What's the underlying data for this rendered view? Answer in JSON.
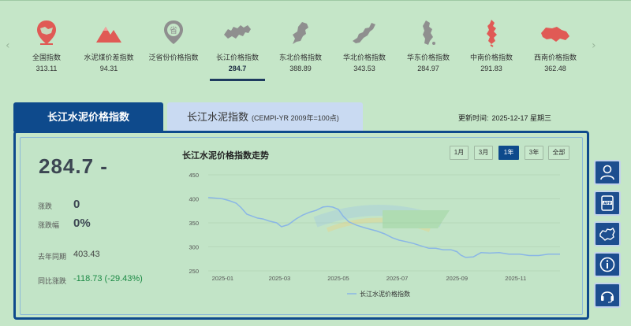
{
  "strip": {
    "prev_arrow": "‹",
    "next_arrow": "›",
    "items": [
      {
        "name": "全国指数",
        "value": "313.11",
        "icon": "location-pin-icon"
      },
      {
        "name": "水泥煤价差指数",
        "value": "94.31",
        "icon": "mountain-icon"
      },
      {
        "name": "泛省份价格指数",
        "value": "",
        "icon": "province-badge-icon",
        "badge": "省"
      },
      {
        "name": "长江价格指数",
        "value": "284.7",
        "icon": "yangtze-region-map-icon"
      },
      {
        "name": "东北价格指数",
        "value": "388.89",
        "icon": "northeast-region-map-icon"
      },
      {
        "name": "华北价格指数",
        "value": "343.53",
        "icon": "north-china-map-icon"
      },
      {
        "name": "华东价格指数",
        "value": "284.97",
        "icon": "east-china-map-icon"
      },
      {
        "name": "中南价格指数",
        "value": "291.83",
        "icon": "central-south-map-icon"
      },
      {
        "name": "西南价格指数",
        "value": "362.48",
        "icon": "southwest-map-icon"
      }
    ]
  },
  "tabs": {
    "active": "长江水泥价格指数",
    "inactive": "长江水泥指数",
    "inactive_sub": "(CEMPI-YR 2009年=100点)"
  },
  "update": {
    "label": "更新时间:",
    "date": "2025-12-17 星期三"
  },
  "summary": {
    "current": "284.7 -",
    "change_label": "涨跌",
    "change_value": "0",
    "pct_label": "涨跌幅",
    "pct_value": "0%",
    "last_year_label": "去年同期",
    "last_year_value": "403.43",
    "yoy_label": "同比涨跌",
    "yoy_value": "-118.73 (-29.43%)"
  },
  "chart_header": {
    "title": "长江水泥价格指数走势",
    "ranges": [
      "1月",
      "3月",
      "1年",
      "3年",
      "全部"
    ],
    "active_range": "1年"
  },
  "side_buttons": [
    "user-icon",
    "app-icon",
    "china-map-icon",
    "info-icon",
    "headset-icon"
  ],
  "colors": {
    "accent": "#0e4a8c",
    "line": "#8ab6e6",
    "positive": "#1c8a45",
    "icon_red": "#e05a55",
    "icon_gray": "#8f8f8f",
    "page_bg": "#c5e6c8"
  },
  "chart_data": {
    "type": "line",
    "title": "长江水泥价格指数走势",
    "x_ticks": [
      "2025-01",
      "2025-03",
      "2025-05",
      "2025-07",
      "2025-09",
      "2025-11"
    ],
    "y_ticks": [
      250,
      300,
      350,
      400,
      450
    ],
    "ylim": [
      250,
      450
    ],
    "xlim": [
      "2024-12-17",
      "2025-12-17"
    ],
    "legend": "bottom-center",
    "grid": true,
    "series": [
      {
        "name": "长江水泥价格指数",
        "x": [
          "2024-12-17",
          "2025-01-01",
          "2025-01-08",
          "2025-01-15",
          "2025-01-20",
          "2025-01-26",
          "2025-02-06",
          "2025-02-12",
          "2025-02-18",
          "2025-02-26",
          "2025-03-03",
          "2025-03-10",
          "2025-03-18",
          "2025-03-25",
          "2025-04-01",
          "2025-04-08",
          "2025-04-15",
          "2025-04-20",
          "2025-04-25",
          "2025-05-01",
          "2025-05-06",
          "2025-05-12",
          "2025-05-20",
          "2025-05-28",
          "2025-06-04",
          "2025-06-10",
          "2025-06-18",
          "2025-06-26",
          "2025-07-03",
          "2025-07-10",
          "2025-07-18",
          "2025-07-26",
          "2025-08-03",
          "2025-08-10",
          "2025-08-18",
          "2025-08-26",
          "2025-09-01",
          "2025-09-05",
          "2025-09-10",
          "2025-09-18",
          "2025-09-26",
          "2025-10-05",
          "2025-10-15",
          "2025-10-25",
          "2025-11-05",
          "2025-11-15",
          "2025-11-25",
          "2025-12-05",
          "2025-12-17"
        ],
        "y": [
          403,
          400,
          396,
          391,
          382,
          368,
          360,
          358,
          354,
          350,
          342,
          346,
          358,
          366,
          372,
          376,
          383,
          384,
          383,
          378,
          364,
          352,
          345,
          340,
          336,
          333,
          327,
          319,
          314,
          311,
          307,
          302,
          297,
          297,
          294,
          294,
          290,
          283,
          278,
          279,
          288,
          287,
          288,
          285,
          285,
          282,
          282,
          285,
          284.7
        ]
      }
    ]
  }
}
